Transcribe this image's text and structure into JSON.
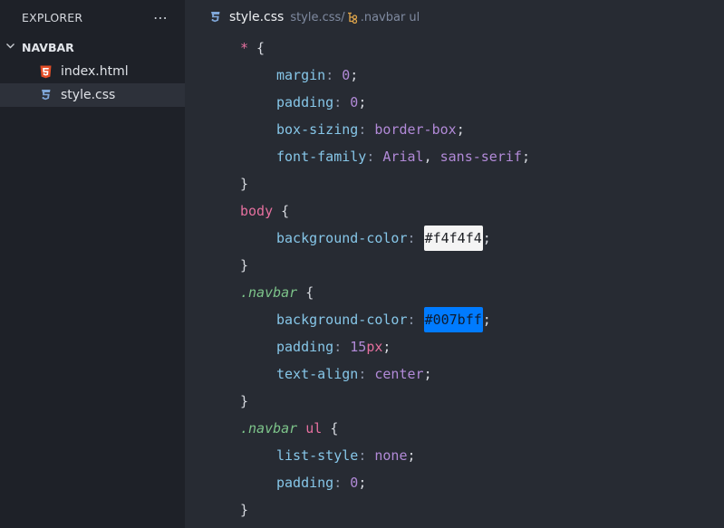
{
  "sidebar": {
    "title": "EXPLORER",
    "more": "⋯",
    "folder": "NAVBAR",
    "files": [
      {
        "name": "index.html",
        "icon": "html5-icon"
      },
      {
        "name": "style.css",
        "icon": "css3-icon"
      }
    ]
  },
  "breadcrumb": {
    "file": "style.css",
    "path": "style.css/",
    "selector": ".navbar ul"
  },
  "code": {
    "l1": {
      "sel": "*",
      "brace": " {"
    },
    "l2": {
      "prop": "margin",
      "val": "0",
      "end": ";"
    },
    "l3": {
      "prop": "padding",
      "val": "0",
      "end": ";"
    },
    "l4": {
      "prop": "box-sizing",
      "val": "border-box",
      "end": ";"
    },
    "l5": {
      "prop": "font-family",
      "val1": "Arial",
      "comma": ", ",
      "val2": "sans-serif",
      "end": ";"
    },
    "l6": {
      "brace": "}"
    },
    "l7": {
      "sel": "body",
      "brace": " {"
    },
    "l8": {
      "prop": "background-color",
      "val": "#f4f4f4",
      "end": ";"
    },
    "l9": {
      "brace": "}"
    },
    "l10": {
      "sel": ".navbar",
      "brace": " {"
    },
    "l11": {
      "prop": "background-color",
      "val": "#007bff",
      "end": ";"
    },
    "l12": {
      "prop": "padding",
      "num": "15",
      "unit": "px",
      "end": ";"
    },
    "l13": {
      "prop": "text-align",
      "val": "center",
      "end": ";"
    },
    "l14": {
      "brace": "}"
    },
    "l15": {
      "sel1": ".navbar",
      "sel2": "ul",
      "brace": " {"
    },
    "l16": {
      "prop": "list-style",
      "val": "none",
      "end": ";"
    },
    "l17": {
      "prop": "padding",
      "val": "0",
      "end": ";"
    },
    "l18": {
      "brace": "}"
    },
    "colon": ": ",
    "space": " "
  },
  "colors": {
    "sidebar_bg": "#1e2128",
    "editor_bg": "#272b33",
    "selector": "#e5709f",
    "class_selector": "#7dc48a",
    "property": "#86c6e8",
    "value": "#b28ad8",
    "swatch_light": "#f4f4f4",
    "swatch_blue": "#007bff"
  }
}
